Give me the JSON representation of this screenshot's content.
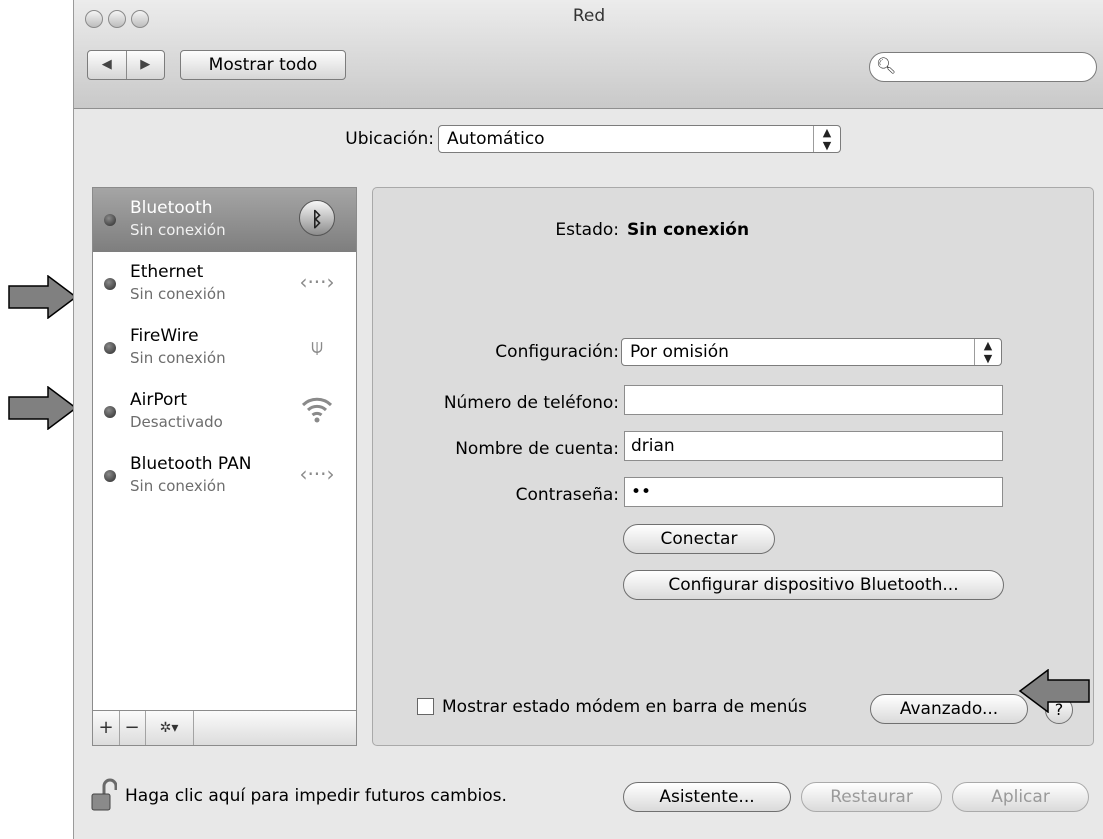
{
  "window": {
    "title": "Red"
  },
  "toolbar": {
    "back_glyph": "◀",
    "forward_glyph": "▶",
    "show_all_label": "Mostrar todo",
    "search_placeholder": ""
  },
  "location": {
    "label": "Ubicación:",
    "value": "Automático"
  },
  "services": [
    {
      "name": "Bluetooth",
      "status": "Sin conexión",
      "icon": "bluetooth-icon",
      "selected": true
    },
    {
      "name": "Ethernet",
      "status": "Sin conexión",
      "icon": "ethernet-icon",
      "selected": false
    },
    {
      "name": "FireWire",
      "status": "Sin conexión",
      "icon": "firewire-icon",
      "selected": false
    },
    {
      "name": "AirPort",
      "status": "Desactivado",
      "icon": "wifi-icon",
      "selected": false
    },
    {
      "name": "Bluetooth PAN",
      "status": "Sin conexión",
      "icon": "ethernet-icon",
      "selected": false
    }
  ],
  "sidebar_tools": {
    "add": "+",
    "remove": "−",
    "gear": "✲▾"
  },
  "detail": {
    "status_label": "Estado:",
    "status_value": "Sin conexión",
    "config_label": "Configuración:",
    "config_value": "Por omisión",
    "phone_label": "Número de teléfono:",
    "phone_value": "",
    "account_label": "Nombre de cuenta:",
    "account_value": "drian",
    "password_label": "Contraseña:",
    "password_value": "••",
    "connect_button": "Conectar",
    "configure_bt_button": "Configurar dispositivo Bluetooth...",
    "show_modem_label": "Mostrar estado módem en barra de menús",
    "show_modem_checked": false,
    "advanced_button": "Avanzado...",
    "help_glyph": "?"
  },
  "footer": {
    "lock_text": "Haga clic aquí para impedir futuros cambios.",
    "assistant_button": "Asistente...",
    "revert_button": "Restaurar",
    "apply_button": "Aplicar"
  },
  "colors": {
    "selected_row": "#8f8f8f",
    "window_bg": "#e8e8e8",
    "annotation_arrow": "#808080"
  }
}
